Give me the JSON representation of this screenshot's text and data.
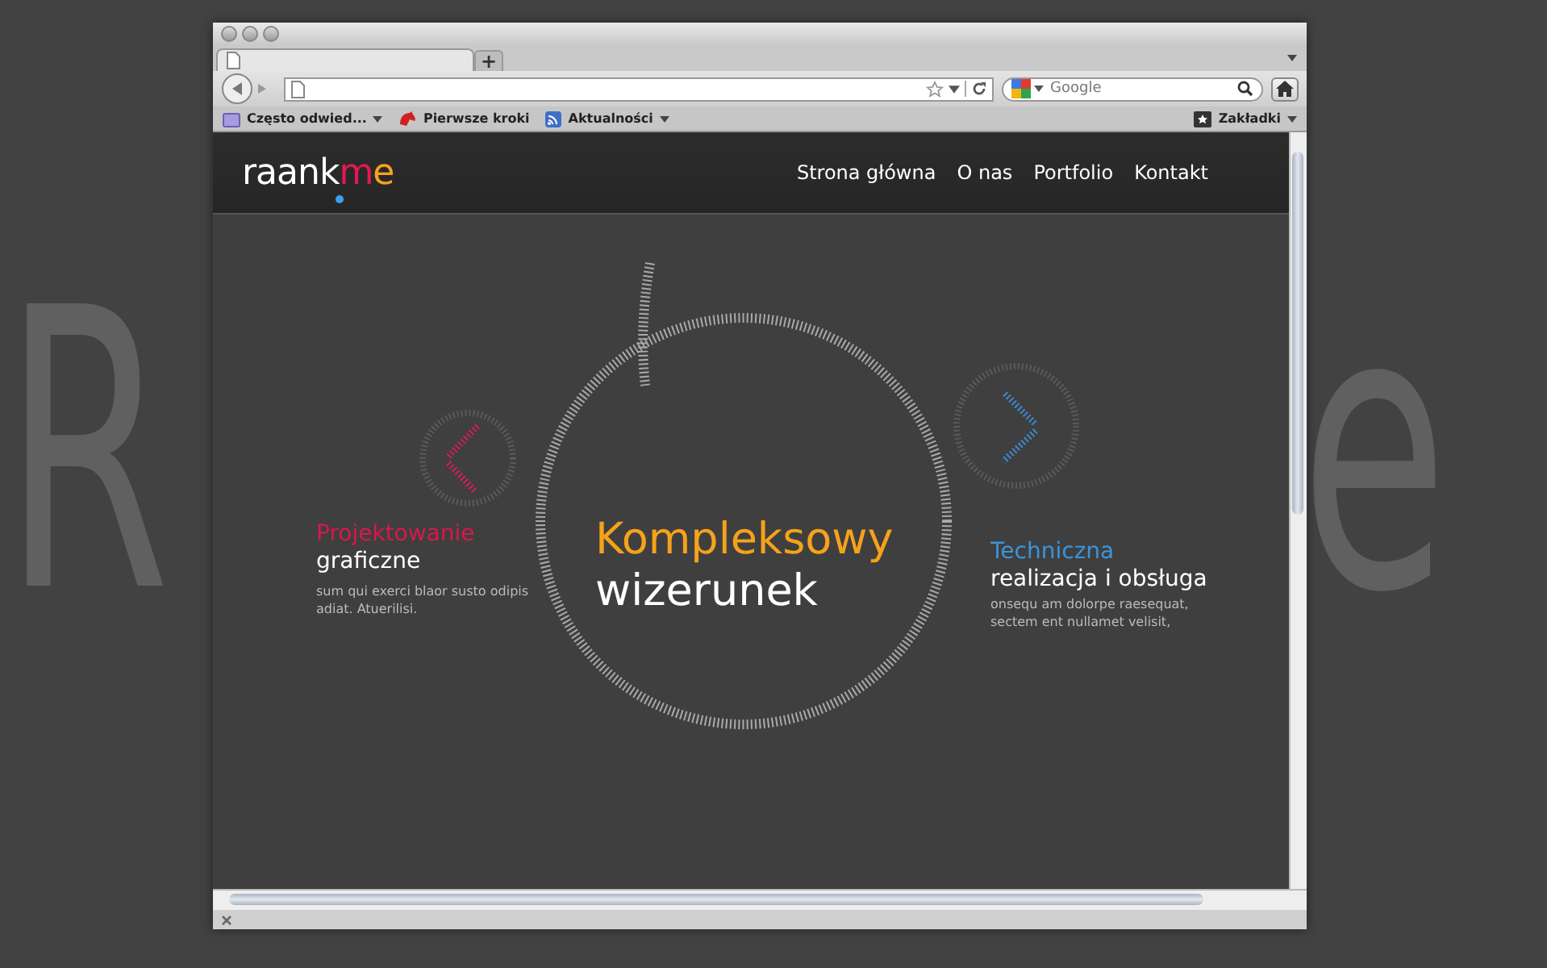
{
  "backdrop": {
    "left_text": "R",
    "right_text": "e"
  },
  "browser": {
    "new_tab": "+",
    "search": {
      "placeholder": "Google"
    },
    "bookmarks": [
      {
        "label": "Często odwied...",
        "menu": true
      },
      {
        "label": "Pierwsze kroki",
        "menu": false
      },
      {
        "label": "Aktualności",
        "menu": true
      }
    ],
    "bookmarks_menu": {
      "label": "Zakładki"
    }
  },
  "site": {
    "logo": [
      {
        "text": "raank",
        "color": "#ffffff"
      },
      {
        "text": "m",
        "color": "#e8174f"
      },
      {
        "text": "e",
        "color": "#f5a21b"
      }
    ],
    "nav": [
      "Strona główna",
      "O nas",
      "Portfolio",
      "Kontakt"
    ],
    "left": {
      "title": "Projektowanie",
      "subtitle": "graficzne",
      "text": "sum qui exerci blaor susto odipis adiat. Atuerilisi."
    },
    "center": {
      "title": "Kompleksowy",
      "subtitle": "wizerunek"
    },
    "right": {
      "title": "Techniczna",
      "subtitle": "realizacja i obsługa",
      "text": "onsequ am dolorpe raesequat, sectem ent nullamet velisit,"
    }
  }
}
